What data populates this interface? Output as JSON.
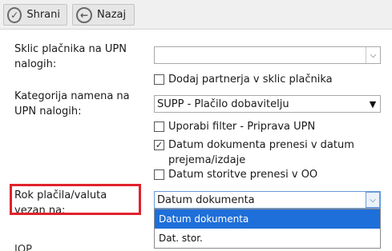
{
  "toolbar": {
    "save_label": "Shrani",
    "back_label": "Nazaj"
  },
  "form": {
    "sklic_label": "Sklic plačnika na UPN nalogih:",
    "sklic_value": "",
    "add_partner_checkbox": {
      "label": "Dodaj partnerja v sklic plačnika",
      "checked": false
    },
    "kategorija_label": "Kategorija namena na UPN nalogih:",
    "kategorija_value": "SUPP - Plačilo dobavitelju",
    "use_filter_checkbox": {
      "label": "Uporabi filter - Priprava UPN",
      "checked": false
    },
    "date_doc_checkbox": {
      "label_line1": "Datum dokumenta prenesi v datum",
      "label_line2": "prejema/izdaje",
      "checked": true
    },
    "date_service_checkbox": {
      "label": "Datum storitve prenesi v OO",
      "checked": false
    },
    "rok_label": "Rok plačila/valuta vezan na:",
    "rok_value": "Datum dokumenta",
    "rok_options": [
      "Datum dokumenta",
      "Dat. stor."
    ],
    "rok_selected_index": 0,
    "cut_row_label": "IOP ..."
  },
  "colors": {
    "highlight": "#e0222c",
    "selection": "#1e6fd9"
  },
  "icons": {
    "save": "check-circle-icon",
    "back": "arrow-left-circle-icon"
  }
}
